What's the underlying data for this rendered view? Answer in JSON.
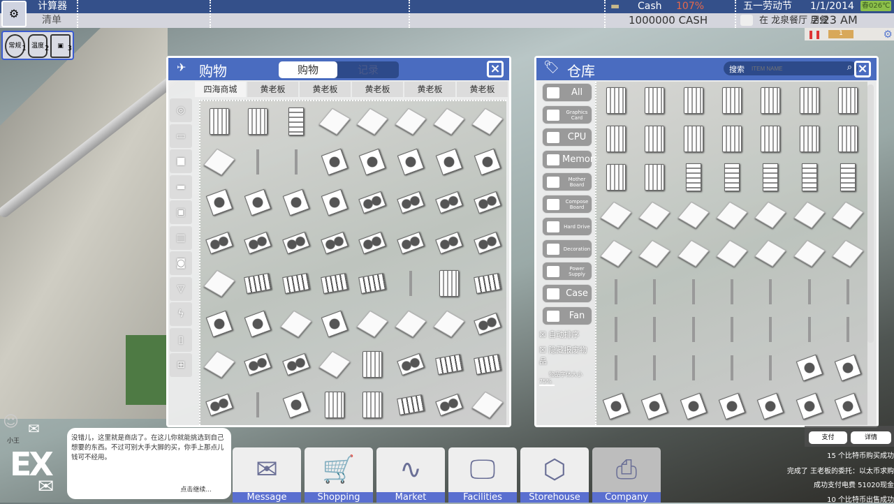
{
  "topbar": {
    "tab1": "计算器",
    "tab2": "清单",
    "cash_label": "Cash",
    "cash_pct": "107%",
    "cash_value": "1000000 CASH",
    "holiday": "五一劳动节",
    "date": "1/1/2014",
    "season_temp": "春026℃",
    "status": "在 龙泉餐厅 用餐",
    "time": "2:23 AM",
    "game_speed": "1"
  },
  "modes": [
    {
      "label": "常规",
      "num": "1"
    },
    {
      "label": "温度",
      "num": "2"
    },
    {
      "label": "",
      "num": "3"
    }
  ],
  "shop": {
    "title": "购物",
    "tabs": [
      "购物",
      "记录"
    ],
    "store_tabs": [
      "四海商城",
      "黄老板",
      "黄老板",
      "黄老板",
      "黄老板",
      "黄老板"
    ],
    "items": [
      [
        "case",
        "case",
        "compose",
        "plate",
        "plate",
        "plate",
        "plate",
        "plate"
      ],
      [
        "plate",
        "fork",
        "fork",
        "cpu",
        "cpu",
        "cpu",
        "cpu",
        "cpu"
      ],
      [
        "cpu",
        "cpu",
        "cpu",
        "cpu",
        "gpu",
        "gpu",
        "gpu",
        "gpu"
      ],
      [
        "gpu",
        "gpu",
        "gpu",
        "gpu",
        "gpu",
        "gpu",
        "gpu",
        "gpu"
      ],
      [
        "plate",
        "mobo",
        "mobo",
        "mobo",
        "mobo",
        "fork",
        "case",
        "mobo"
      ],
      [
        "cpu",
        "cpu",
        "plate",
        "cpu",
        "plate",
        "plate",
        "plate",
        "gpu"
      ],
      [
        "plate",
        "gpu",
        "gpu",
        "plate",
        "case",
        "gpu",
        "mobo",
        "mobo"
      ],
      [
        "gpu",
        "fork",
        "cpu",
        "case",
        "case",
        "mobo",
        "gpu",
        "plate"
      ]
    ]
  },
  "storehouse": {
    "title": "仓库",
    "search_label": "搜索",
    "search_placeholder": "ITEM NAME",
    "categories": [
      "All",
      "Graphics Card",
      "CPU",
      "Memory",
      "Mother Board",
      "Compose Board",
      "Hard Drive",
      "Decoration",
      "Power Supply",
      "Case",
      "Fan"
    ],
    "options": {
      "auto_sort": "自动排序",
      "hide_scrapped": "隐藏报废物品",
      "font_size_label": "物品字体大小",
      "font_size_value": "75%"
    },
    "items": [
      [
        "case",
        "case",
        "case",
        "case",
        "case",
        "case",
        "case"
      ],
      [
        "case",
        "case",
        "case",
        "case",
        "case",
        "case",
        "case"
      ],
      [
        "case",
        "case",
        "compose",
        "compose",
        "compose",
        "compose",
        "compose"
      ],
      [
        "plate",
        "plate",
        "plate",
        "plate",
        "plate",
        "plate",
        "plate"
      ],
      [
        "plate",
        "plate",
        "plate",
        "plate",
        "plate",
        "plate",
        "plate"
      ],
      [
        "fork",
        "fork",
        "fork",
        "fork",
        "fork",
        "fork",
        "fork"
      ],
      [
        "fork",
        "fork",
        "fork",
        "fork",
        "fork",
        "fork",
        "fork"
      ],
      [
        "fork",
        "fork",
        "fork",
        "fork",
        "fork",
        "cpu",
        "cpu"
      ],
      [
        "cpu",
        "cpu",
        "cpu",
        "cpu",
        "cpu",
        "cpu",
        "cpu"
      ]
    ]
  },
  "npc": {
    "name": "小王",
    "badge": "EX",
    "message": "没错儿，这里就是商店了。在这儿你就能挑选到自己想要的东西。不过可别大手大脚的买，你手上那点儿钱可不经用。",
    "continue": "点击继续..."
  },
  "dock": [
    {
      "label": "Message",
      "icon": "✉"
    },
    {
      "label": "Shopping",
      "icon": "🛒"
    },
    {
      "label": "Market",
      "icon": "∿"
    },
    {
      "label": "Facilities",
      "icon": "🖵"
    },
    {
      "label": "Storehouse",
      "icon": "⬡"
    },
    {
      "label": "Company",
      "icon": "⎙"
    }
  ],
  "side_buttons": {
    "pay": "支付",
    "details": "详情"
  },
  "log": [
    "15 个比特币购买成功",
    "完成了 王老板的委托：以太币求购",
    "成功支付电费 51020现金",
    "10 个比特币出售成功"
  ],
  "colors": {
    "header_blue": "#34508a",
    "panel_blue": "#4a6cc0",
    "dock_label": "#5a6fd0",
    "cash_pct": "#e8684a",
    "season": "#8cc04a"
  }
}
